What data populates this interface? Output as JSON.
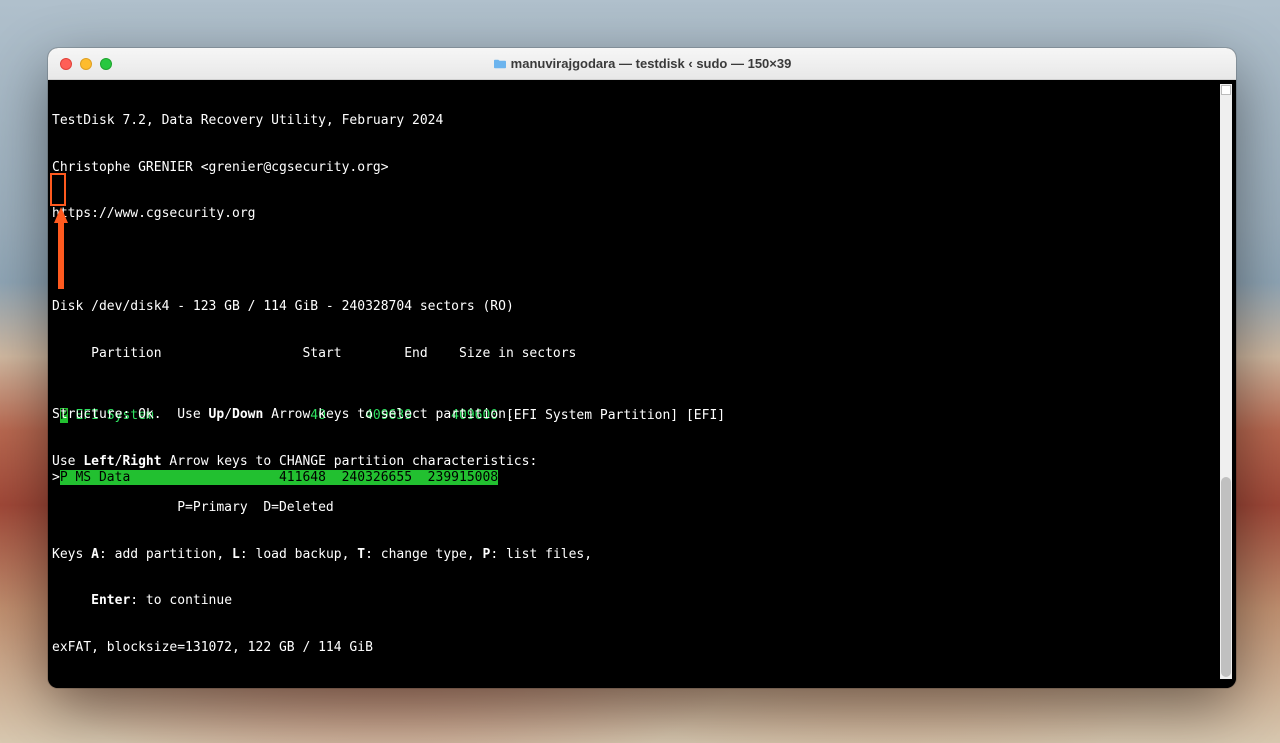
{
  "window": {
    "title": "manuvirajgodara — testdisk ‹ sudo — 150×39"
  },
  "header": {
    "line1": "TestDisk 7.2, Data Recovery Utility, February 2024",
    "line2": "Christophe GRENIER <grenier@cgsecurity.org>",
    "line3": "https://www.cgsecurity.org"
  },
  "disk_line": "Disk /dev/disk4 - 123 GB / 114 GiB - 240328704 sectors (RO)",
  "columns": "     Partition                  Start        End    Size in sectors",
  "partitions": [
    {
      "selected": false,
      "status": "P",
      "name": "EFI System",
      "start": "40",
      "end": "409639",
      "size": "409600",
      "label_text": " [EFI System Partition] [EFI]",
      "row_text": " EFI System                    40     409639     409600"
    },
    {
      "selected": true,
      "status": "P",
      "name": "MS Data",
      "start": "411648",
      "end": "240326655",
      "size": "239915008",
      "label_text": "",
      "row_text": " MS Data                   411648  240326655  239915008"
    }
  ],
  "footer": {
    "structure_prefix": "Structure: Ok.  Use ",
    "structure_key1": "Up",
    "structure_sep": "/",
    "structure_key2": "Down",
    "structure_suffix": " Arrow keys to select partition.",
    "use_prefix": "Use ",
    "use_key1": "Left",
    "use_sep": "/",
    "use_key2": "Right",
    "use_suffix": " Arrow keys to CHANGE partition characteristics:",
    "legend": "                P=Primary  D=Deleted",
    "keys_prefix": "Keys ",
    "key_a": "A",
    "key_a_desc": ": add partition, ",
    "key_l": "L",
    "key_l_desc": ": load backup, ",
    "key_t": "T",
    "key_t_desc": ": change type, ",
    "key_p": "P",
    "key_p_desc": ": list files,",
    "enter_prefix": "     ",
    "enter_key": "Enter",
    "enter_desc": ": to continue",
    "fs_info": "exFAT, blocksize=131072, 122 GB / 114 GiB"
  },
  "annotation": {
    "color": "#ff5a1f"
  }
}
